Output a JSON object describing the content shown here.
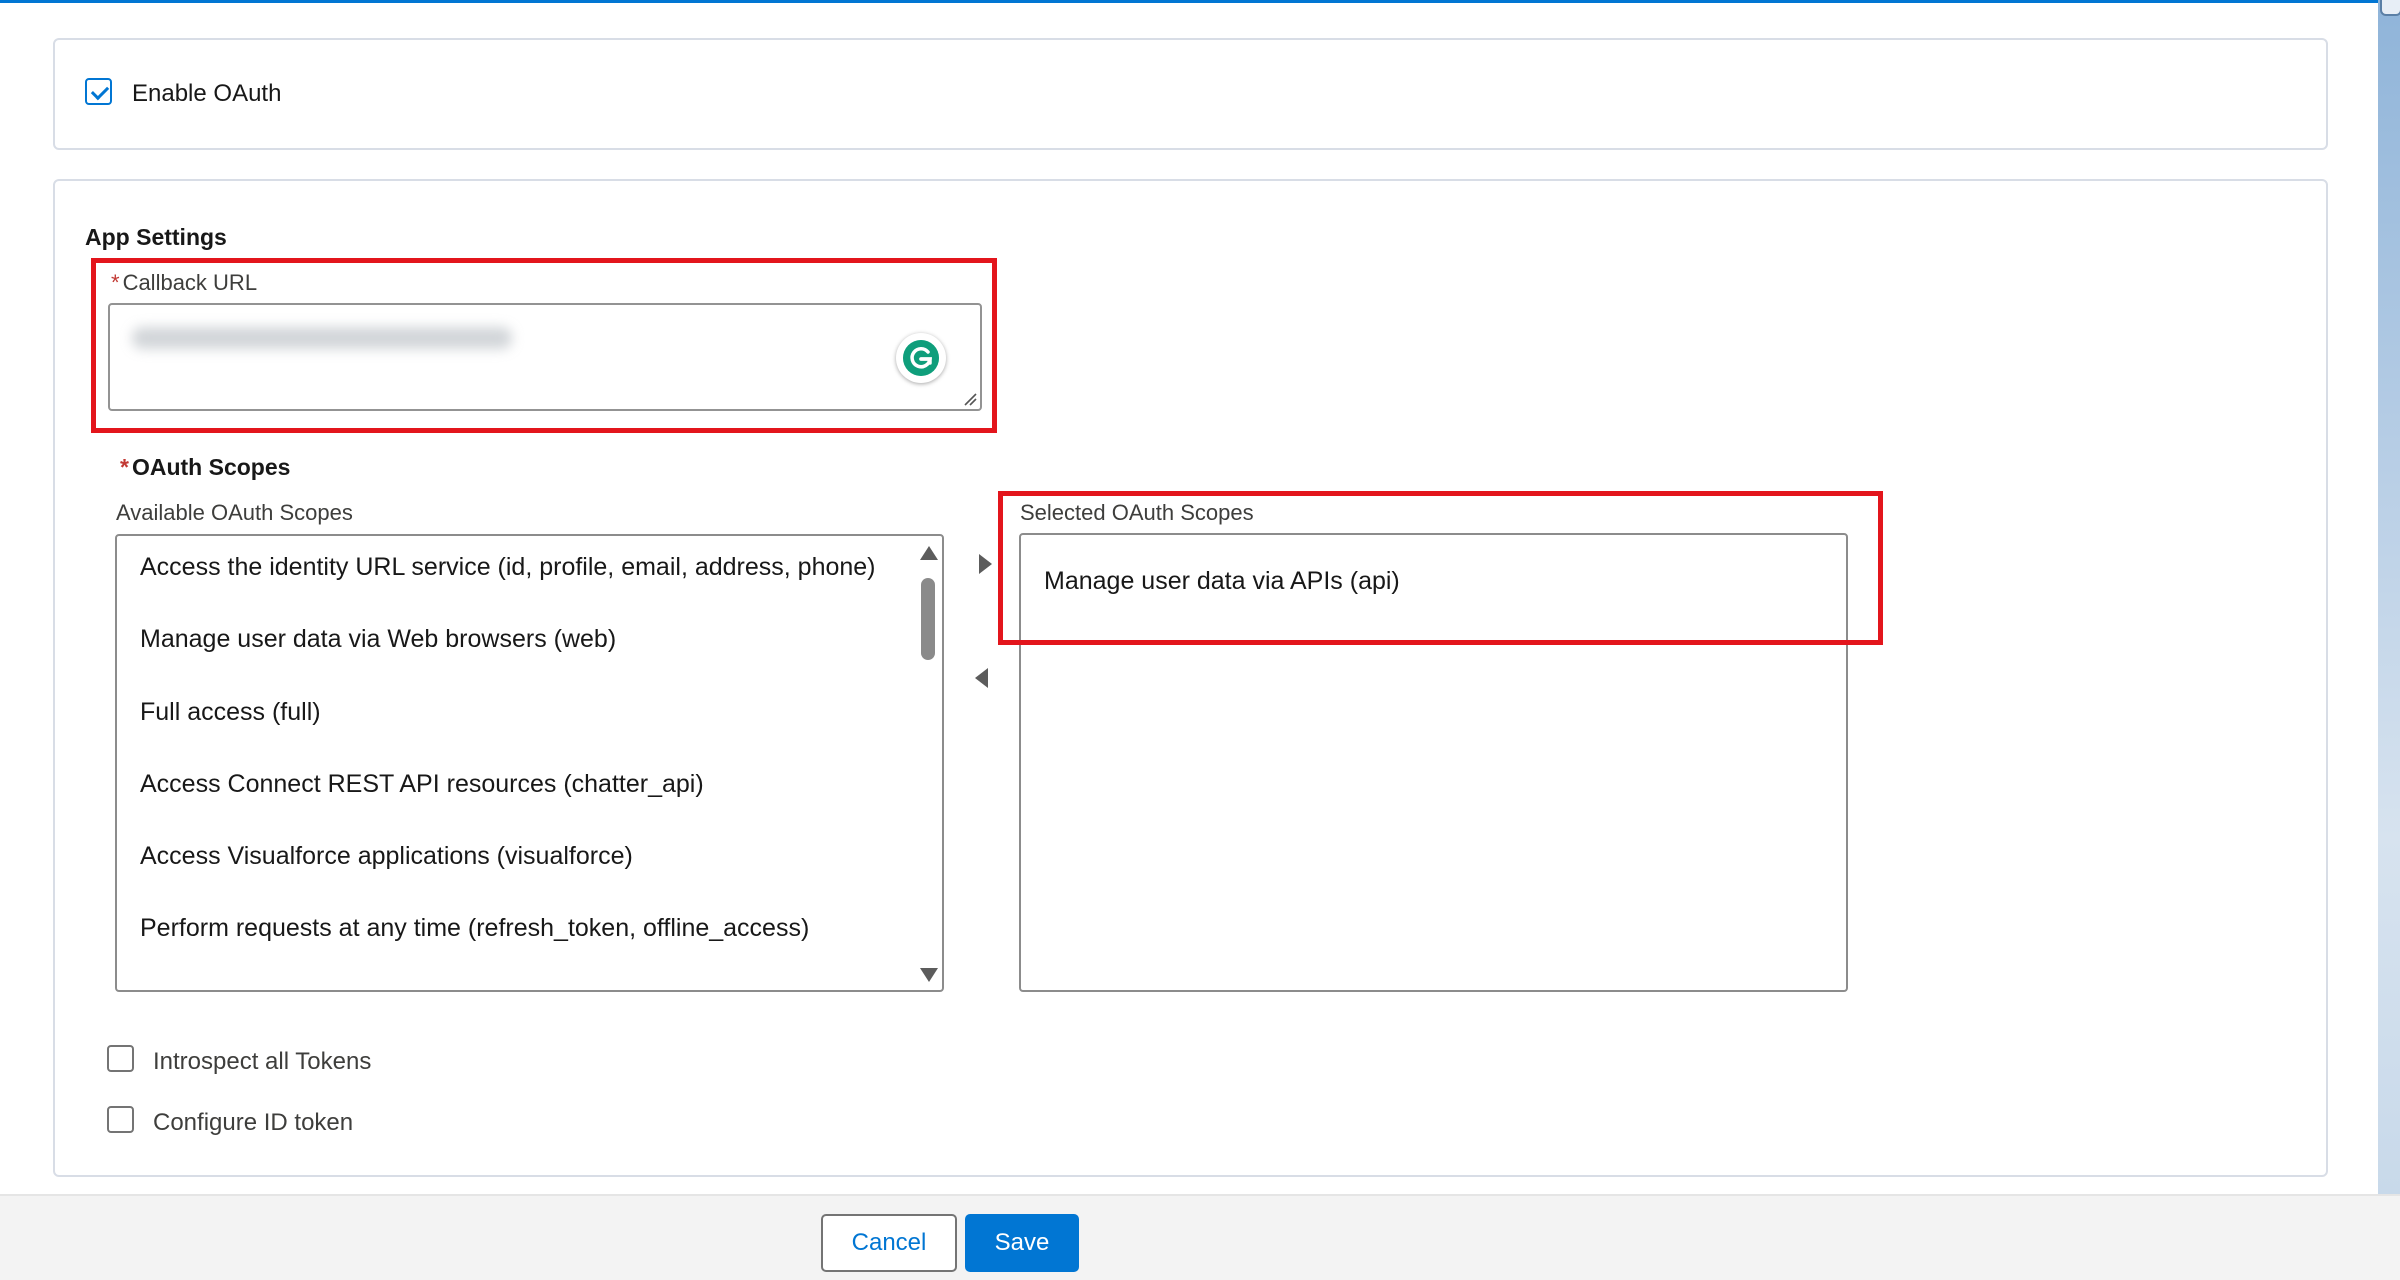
{
  "enable_oauth": {
    "label": "Enable OAuth",
    "checked": true
  },
  "app_settings": {
    "title": "App Settings",
    "callback_url": {
      "required_mark": "*",
      "label": "Callback URL"
    }
  },
  "oauth_scopes": {
    "required_mark": "*",
    "title": "OAuth Scopes",
    "available_label": "Available OAuth Scopes",
    "available": [
      "Access the identity URL service (id, profile, email, address, phone)",
      "Manage user data via Web browsers (web)",
      "Full access (full)",
      "Access Connect REST API resources (chatter_api)",
      "Access Visualforce applications (visualforce)",
      "Perform requests at any time (refresh_token, offline_access)"
    ],
    "selected_label": "Selected OAuth Scopes",
    "selected": [
      "Manage user data via APIs (api)"
    ]
  },
  "options": {
    "introspect": {
      "label": "Introspect all Tokens",
      "checked": false
    },
    "configure_id_token": {
      "label": "Configure ID token",
      "checked": false
    }
  },
  "footer": {
    "cancel_label": "Cancel",
    "save_label": "Save"
  },
  "colors": {
    "brand": "#0176d3",
    "highlight": "#e3151c",
    "required": "#c23934"
  }
}
